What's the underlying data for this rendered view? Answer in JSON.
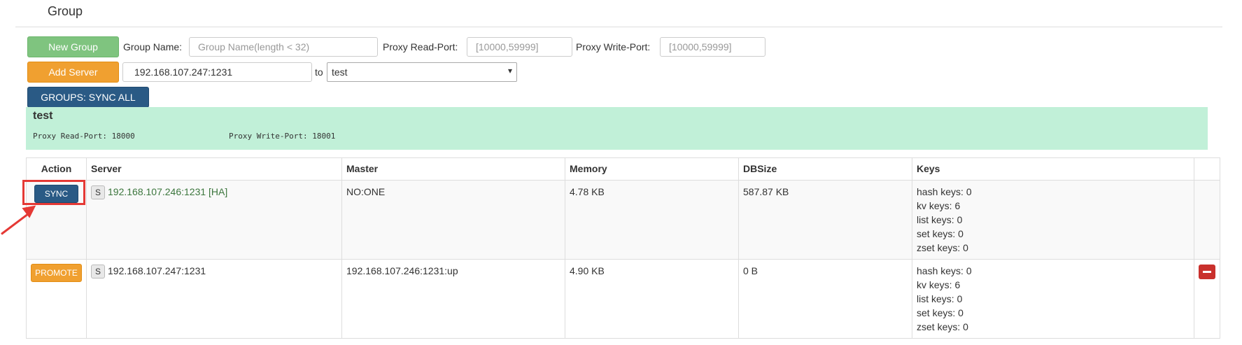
{
  "page": {
    "title": "Group"
  },
  "toolbar": {
    "new_group_label": "New Group",
    "group_name_label": "Group Name:",
    "group_name_placeholder": "Group Name(length < 32)",
    "proxy_read_label": "Proxy Read-Port:",
    "proxy_read_placeholder": "[10000,59999]",
    "proxy_write_label": "Proxy Write-Port:",
    "proxy_write_placeholder": "[10000,59999]",
    "add_server_label": "Add Server",
    "server_value": "192.168.107.247:1231",
    "to_label": "to",
    "target_group": "test",
    "sync_all_label": "GROUPS: SYNC ALL"
  },
  "group": {
    "name": "test",
    "read_port": "Proxy Read-Port: 18000",
    "write_port": "Proxy Write-Port: 18001"
  },
  "table": {
    "headers": [
      "Action",
      "Server",
      "Master",
      "Memory",
      "DBSize",
      "Keys"
    ],
    "rows": [
      {
        "action": "SYNC",
        "badge": "S",
        "server": "192.168.107.246:1231 [HA]",
        "master": "NO:ONE",
        "memory": "4.78 KB",
        "dbsize": "587.87 KB",
        "keys": [
          "hash keys: 0",
          "kv keys: 6",
          "list keys: 0",
          "set keys: 0",
          "zset keys: 0"
        ]
      },
      {
        "action": "PROMOTE",
        "badge": "S",
        "server": "192.168.107.247:1231",
        "master": "192.168.107.246:1231:up",
        "memory": "4.90 KB",
        "dbsize": "0 B",
        "keys": [
          "hash keys: 0",
          "kv keys: 6",
          "list keys: 0",
          "set keys: 0",
          "zset keys: 0"
        ]
      }
    ]
  },
  "colors": {
    "success": "#7fc47f",
    "warning": "#f0a030",
    "primary": "#2a5a85",
    "danger": "#c9302c",
    "group_panel": "#c1f0d8",
    "annotation": "#e53935"
  },
  "icons": {
    "remove": "minus-icon",
    "annotation": "arrow-annotation"
  }
}
